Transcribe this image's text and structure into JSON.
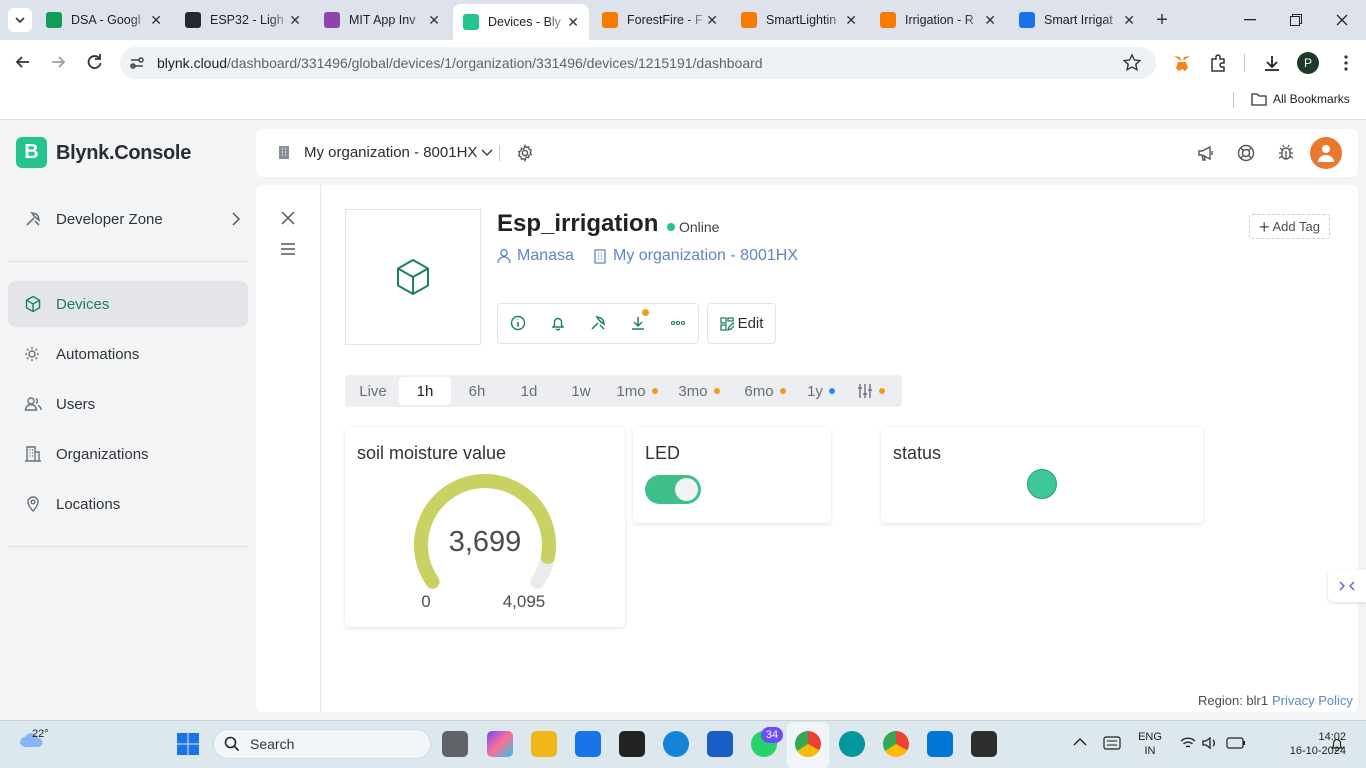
{
  "browser": {
    "tabs": [
      {
        "title": "DSA - Googl",
        "color": "#0f9d58"
      },
      {
        "title": "ESP32 - Ligh",
        "color": "#24292f"
      },
      {
        "title": "MIT App Inv",
        "color": "#8e44ad"
      },
      {
        "title": "Devices - Bly",
        "color": "#23c48e",
        "active": true
      },
      {
        "title": "ForestFire - F",
        "color": "#f57c00"
      },
      {
        "title": "SmartLightin",
        "color": "#f57c00"
      },
      {
        "title": "Irrigation - R",
        "color": "#f57c00"
      },
      {
        "title": "Smart Irrigat",
        "color": "#1a73e8"
      }
    ],
    "url_host": "blynk.cloud",
    "url_path": "/dashboard/331496/global/devices/1/organization/331496/devices/1215191/dashboard",
    "profile_initial": "P",
    "bookmarks_label": "All Bookmarks"
  },
  "app": {
    "brand_letter": "B",
    "brand": "Blynk.Console",
    "org_selector": "My organization - 8001HX",
    "sidebar": {
      "developer_zone": "Developer Zone",
      "items": [
        {
          "label": "Devices",
          "icon": "cube-icon",
          "active": true
        },
        {
          "label": "Automations",
          "icon": "automation-icon"
        },
        {
          "label": "Users",
          "icon": "users-icon"
        },
        {
          "label": "Organizations",
          "icon": "building-icon"
        },
        {
          "label": "Locations",
          "icon": "location-pin-icon"
        }
      ]
    },
    "device": {
      "name": "Esp_irrigation",
      "status": "Online",
      "owner": "Manasa",
      "organization": "My organization - 8001HX",
      "edit_label": "Edit",
      "add_tag_label": "Add Tag"
    },
    "time_ranges": [
      {
        "label": "Live"
      },
      {
        "label": "1h",
        "selected": true
      },
      {
        "label": "6h"
      },
      {
        "label": "1d"
      },
      {
        "label": "1w"
      },
      {
        "label": "1mo",
        "dot": "#f29d1a"
      },
      {
        "label": "3mo",
        "dot": "#f29d1a"
      },
      {
        "label": "6mo",
        "dot": "#f29d1a"
      },
      {
        "label": "1y",
        "dot": "#1a8cff"
      }
    ],
    "widgets": {
      "gauge": {
        "title": "soil moisture value",
        "value": 3699,
        "value_label": "3,699",
        "min_label": "0",
        "max_label": "4,095",
        "min": 0,
        "max": 4095,
        "color": "#c8d162"
      },
      "led_switch": {
        "title": "LED",
        "on": true,
        "color": "#3fbf8a"
      },
      "status": {
        "title": "status",
        "led_color": "#3ec79a"
      }
    },
    "footer": {
      "region": "Region: blr1",
      "privacy": "Privacy Policy"
    }
  },
  "taskbar": {
    "weather": "22°",
    "search_placeholder": "Search",
    "badge_count": "34",
    "lang_line1": "ENG",
    "lang_line2": "IN",
    "time": "14:02",
    "date": "16-10-2024"
  }
}
